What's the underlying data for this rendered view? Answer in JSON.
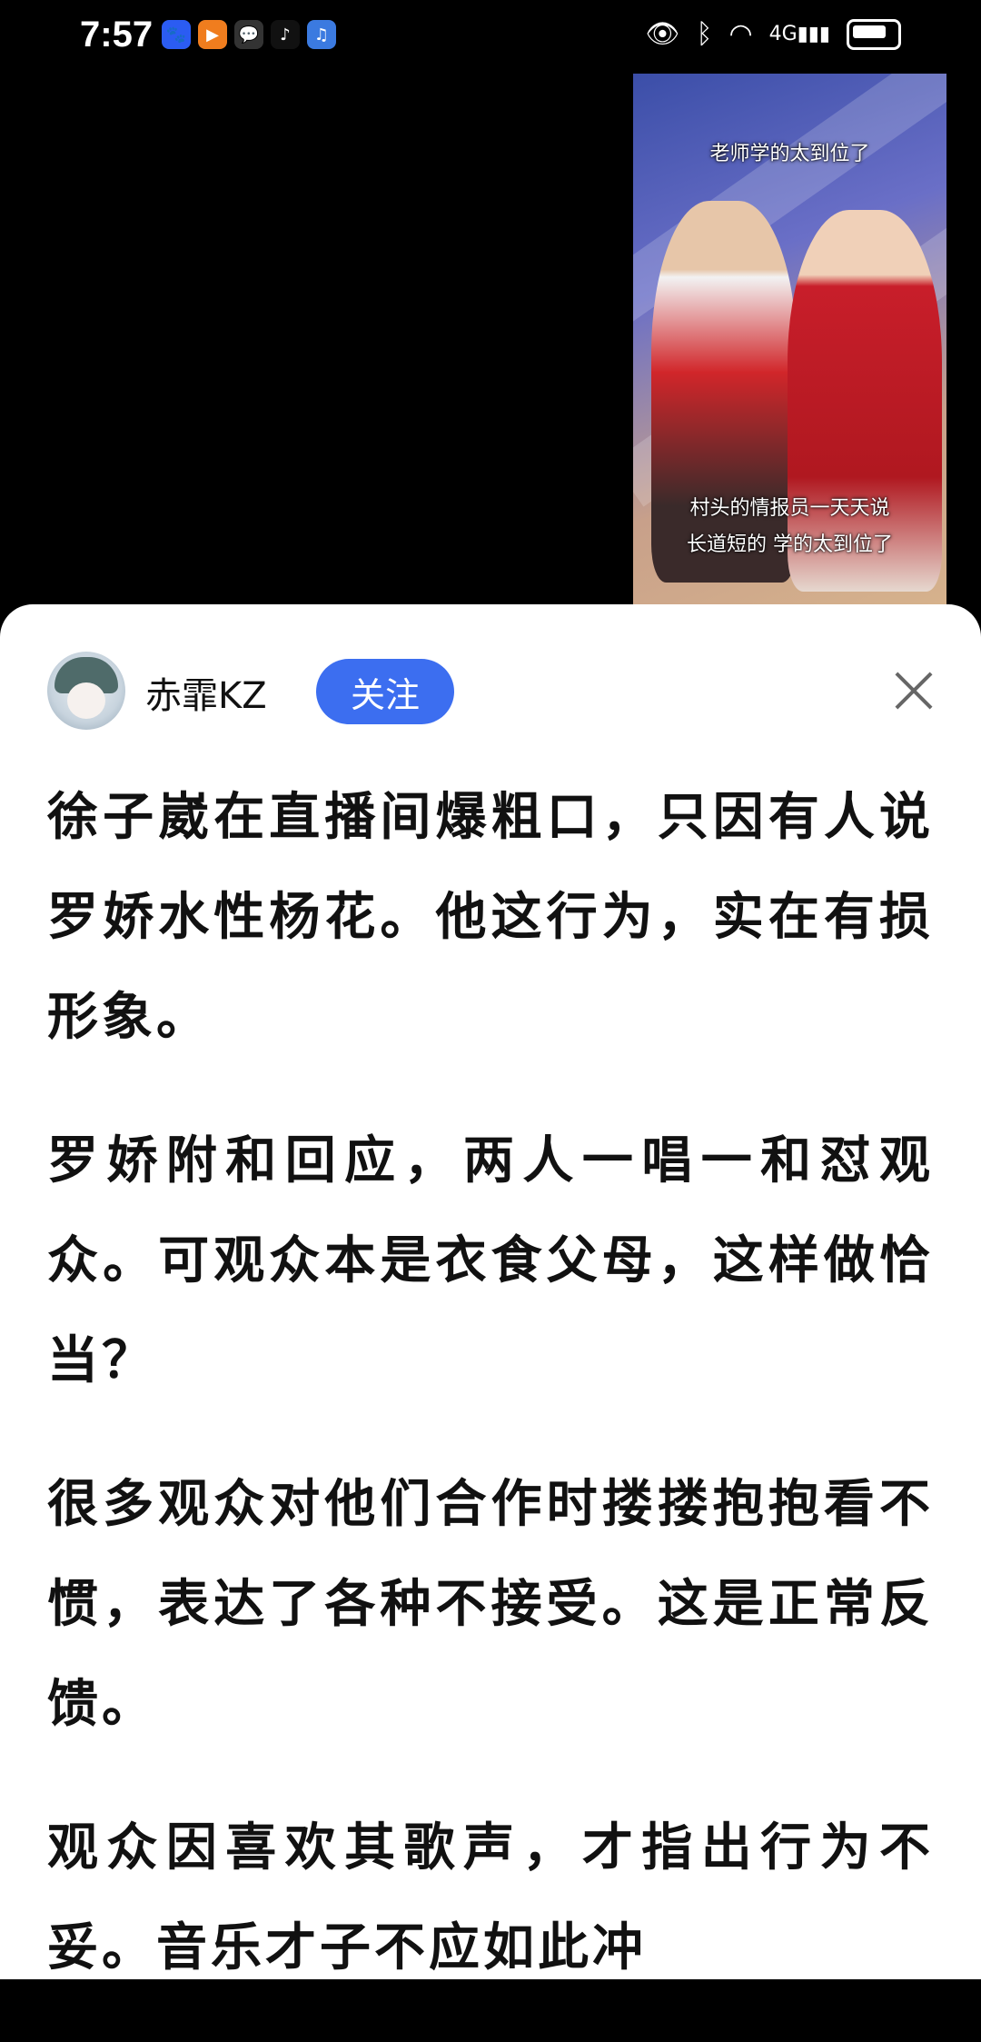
{
  "status_bar": {
    "time": "7:57",
    "app_icons": [
      "baidu-icon",
      "video-icon",
      "wechat-icon",
      "tiktok-icon",
      "music-icon"
    ],
    "network_label": "4G"
  },
  "video": {
    "caption_top": "老师学的太到位了",
    "caption_line1": "村头的情报员一天天说",
    "caption_line2": "长道短的 学的太到位了"
  },
  "author": {
    "name": "赤霏KZ",
    "follow_label": "关注"
  },
  "article": {
    "paragraphs": [
      "徐子崴在直播间爆粗口，只因有人说罗娇水性杨花。他这行为，实在有损形象。",
      "罗娇附和回应，两人一唱一和怼观众。可观众本是衣食父母，这样做恰当？",
      "很多观众对他们合作时搂搂抱抱看不惯，表达了各种不接受。这是正常反馈。",
      "观众因喜欢其歌声，才指出行为不妥。音乐才子不应如此冲"
    ]
  },
  "colors": {
    "accent": "#3c6ef0",
    "background_top": "#000000",
    "sheet": "#ffffff"
  }
}
